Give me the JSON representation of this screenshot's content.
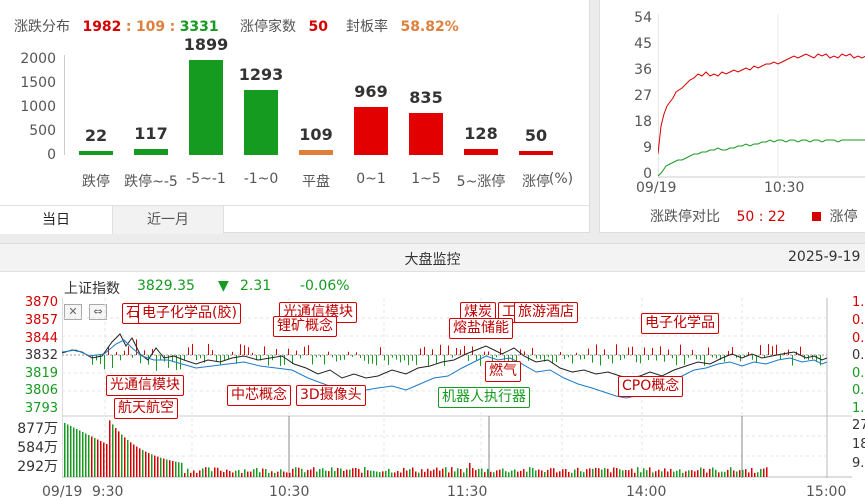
{
  "stats": {
    "dist_label": "涨跌分布",
    "up": "1982",
    "sep1": ":",
    "flat": "109",
    "sep2": ":",
    "down": "3331",
    "limit_label": "涨停家数",
    "limit_value": "50",
    "seal_label": "封板率",
    "seal_value": "58.82%"
  },
  "dist_chart": {
    "y_ticks": [
      "2000",
      "1500",
      "1000",
      "500",
      "0"
    ],
    "unit": "(%)"
  },
  "chart_data": [
    {
      "type": "bar",
      "categories": [
        "跌停",
        "跌停~-5",
        "-5~-1",
        "-1~0",
        "平盘",
        "0~1",
        "1~5",
        "5~涨停",
        "涨停"
      ],
      "values": [
        22,
        117,
        1899,
        1293,
        109,
        969,
        835,
        128,
        50
      ],
      "value_labels": [
        "22",
        "117",
        "1899",
        "1293",
        "109",
        "969",
        "835",
        "128",
        "50"
      ],
      "colors": [
        "#159b1f",
        "#159b1f",
        "#159b1f",
        "#159b1f",
        "#e07f3c",
        "#e20000",
        "#e20000",
        "#e20000",
        "#e20000"
      ],
      "ylim": [
        0,
        2000
      ]
    }
  ],
  "tabs": [
    {
      "label": "当日",
      "active": true
    },
    {
      "label": "近一月",
      "active": false
    }
  ],
  "mini_chart": {
    "y_ticks": [
      "54",
      "45",
      "36",
      "27",
      "18",
      "9",
      "0"
    ],
    "x_ticks": [
      "09/19",
      "10:30"
    ],
    "legend_label": "涨跌停对比",
    "legend_value": "50 : 22",
    "legend_series": "涨停",
    "up_color": "#d40000",
    "down_color": "#159b1f"
  },
  "monitor": {
    "title": "大盘监控",
    "date": "2025-9-19",
    "index_name": "上证指数",
    "index_value": "3829.35",
    "change_arrow": "▼",
    "change": "2.31",
    "change_pct": "-0.06%",
    "left_scale": [
      "3870",
      "3857",
      "3844",
      "3832",
      "3819",
      "3806",
      "3793"
    ],
    "right_scale": [
      "1.",
      "0.",
      "0.",
      "0.",
      "0.",
      "0.",
      "1."
    ],
    "vol_scale": [
      "877万",
      "584万",
      "292万"
    ],
    "vol_right": [
      "27",
      "18",
      "9."
    ],
    "time_ticks": [
      "09/19",
      "9:30",
      "10:30",
      "11:30",
      "14:00",
      "15:00"
    ],
    "annotations": [
      {
        "text": "电子化学品(胶)",
        "kind": "red"
      },
      {
        "text": "光通信模块",
        "kind": "red"
      },
      {
        "text": "锂矿概念",
        "kind": "red"
      },
      {
        "text": "煤炭",
        "kind": "red"
      },
      {
        "text": "工",
        "kind": "red"
      },
      {
        "text": "旅游酒店",
        "kind": "red"
      },
      {
        "text": "熔盐储能",
        "kind": "red"
      },
      {
        "text": "电子化学品",
        "kind": "red"
      },
      {
        "text": "光通信模块",
        "kind": "red"
      },
      {
        "text": "航天航空",
        "kind": "red"
      },
      {
        "text": "中芯概念",
        "kind": "red"
      },
      {
        "text": "3D摄像头",
        "kind": "red"
      },
      {
        "text": "燃气",
        "kind": "red"
      },
      {
        "text": "机器人执行器",
        "kind": "green"
      },
      {
        "text": "CPO概念",
        "kind": "red"
      },
      {
        "text": "石",
        "kind": "red"
      }
    ]
  }
}
